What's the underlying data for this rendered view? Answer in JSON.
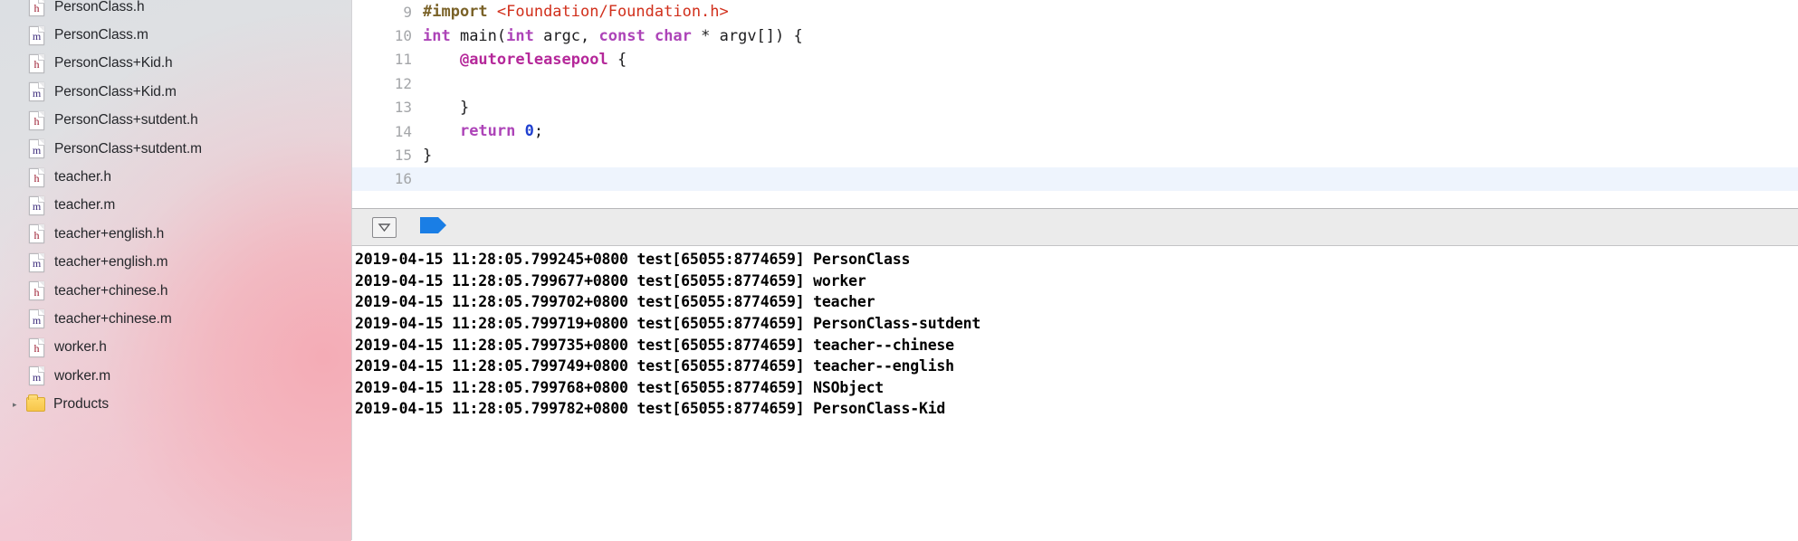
{
  "sidebar": {
    "files": [
      {
        "ext": "h",
        "icon": "objc-header-file-icon",
        "label": "PersonClass.h"
      },
      {
        "ext": "m",
        "icon": "objc-source-file-icon",
        "label": "PersonClass.m"
      },
      {
        "ext": "h",
        "icon": "objc-header-file-icon",
        "label": "PersonClass+Kid.h"
      },
      {
        "ext": "m",
        "icon": "objc-source-file-icon",
        "label": "PersonClass+Kid.m"
      },
      {
        "ext": "h",
        "icon": "objc-header-file-icon",
        "label": "PersonClass+sutdent.h"
      },
      {
        "ext": "m",
        "icon": "objc-source-file-icon",
        "label": "PersonClass+sutdent.m"
      },
      {
        "ext": "h",
        "icon": "objc-header-file-icon",
        "label": "teacher.h"
      },
      {
        "ext": "m",
        "icon": "objc-source-file-icon",
        "label": "teacher.m"
      },
      {
        "ext": "h",
        "icon": "objc-header-file-icon",
        "label": "teacher+english.h"
      },
      {
        "ext": "m",
        "icon": "objc-source-file-icon",
        "label": "teacher+english.m"
      },
      {
        "ext": "h",
        "icon": "objc-header-file-icon",
        "label": "teacher+chinese.h"
      },
      {
        "ext": "m",
        "icon": "objc-source-file-icon",
        "label": "teacher+chinese.m"
      },
      {
        "ext": "h",
        "icon": "objc-header-file-icon",
        "label": "worker.h"
      },
      {
        "ext": "m",
        "icon": "objc-source-file-icon",
        "label": "worker.m"
      }
    ],
    "group": {
      "label": "Products",
      "disclosure": "▸"
    }
  },
  "editor": {
    "lines": [
      {
        "number": "9",
        "current": false,
        "tokens": [
          {
            "t": "#import ",
            "c": "pre"
          },
          {
            "t": "<Foundation/Foundation.h>",
            "c": "str"
          }
        ]
      },
      {
        "number": "10",
        "current": false,
        "tokens": [
          {
            "t": "int",
            "c": "kw"
          },
          {
            "t": " main(",
            "c": "plain"
          },
          {
            "t": "int",
            "c": "kw"
          },
          {
            "t": " argc, ",
            "c": "plain"
          },
          {
            "t": "const",
            "c": "kw"
          },
          {
            "t": " ",
            "c": "plain"
          },
          {
            "t": "char",
            "c": "kw"
          },
          {
            "t": " * argv[]) {",
            "c": "plain"
          }
        ]
      },
      {
        "number": "11",
        "current": false,
        "tokens": [
          {
            "t": "    ",
            "c": "plain"
          },
          {
            "t": "@autoreleasepool",
            "c": "kw2"
          },
          {
            "t": " {",
            "c": "plain"
          }
        ]
      },
      {
        "number": "12",
        "current": false,
        "tokens": [
          {
            "t": "",
            "c": "plain"
          }
        ]
      },
      {
        "number": "13",
        "current": false,
        "tokens": [
          {
            "t": "    }",
            "c": "plain"
          }
        ]
      },
      {
        "number": "14",
        "current": false,
        "tokens": [
          {
            "t": "    ",
            "c": "plain"
          },
          {
            "t": "return",
            "c": "kw"
          },
          {
            "t": " ",
            "c": "plain"
          },
          {
            "t": "0",
            "c": "num"
          },
          {
            "t": ";",
            "c": "plain"
          }
        ]
      },
      {
        "number": "15",
        "current": false,
        "tokens": [
          {
            "t": "}",
            "c": "plain"
          }
        ]
      },
      {
        "number": "16",
        "current": true,
        "tokens": [
          {
            "t": "",
            "c": "plain"
          }
        ]
      }
    ]
  },
  "debug_bar": {
    "buttons": [
      {
        "name": "hide-debug-area-button",
        "icon": "triangle-down-in-box-icon"
      },
      {
        "name": "breakpoints-toggle-button",
        "icon": "blue-breakpoint-flag-icon",
        "color": "#1a7ee5"
      }
    ]
  },
  "console": {
    "lines": [
      "2019-04-15 11:28:05.799245+0800 test[65055:8774659] PersonClass",
      "2019-04-15 11:28:05.799677+0800 test[65055:8774659] worker",
      "2019-04-15 11:28:05.799702+0800 test[65055:8774659] teacher",
      "2019-04-15 11:28:05.799719+0800 test[65055:8774659] PersonClass-sutdent",
      "2019-04-15 11:28:05.799735+0800 test[65055:8774659] teacher--chinese",
      "2019-04-15 11:28:05.799749+0800 test[65055:8774659] teacher--english",
      "2019-04-15 11:28:05.799768+0800 test[65055:8774659] NSObject",
      "2019-04-15 11:28:05.799782+0800 test[65055:8774659] PersonClass-Kid"
    ]
  },
  "colors": {
    "accent": "#1a7ee5",
    "keyword": "#ad44b8",
    "directive": "#b5289a",
    "string": "#d12f1b",
    "number": "#2040d0",
    "preprocessor": "#7a6228",
    "current_line": "#eef4fd"
  }
}
